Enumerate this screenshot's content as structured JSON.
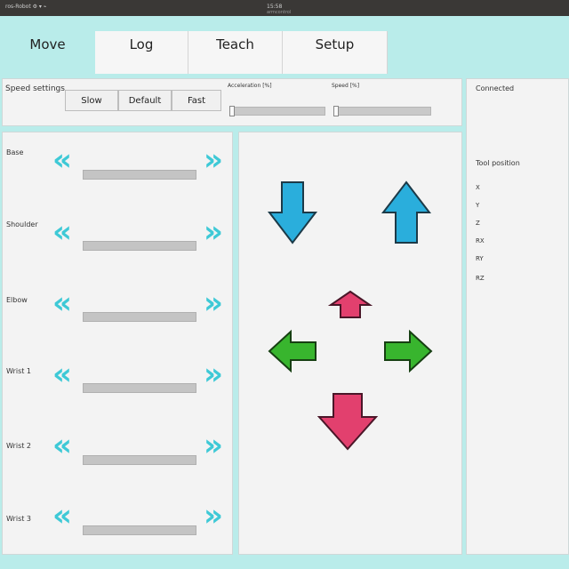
{
  "titlebar": {
    "left": "ros-Robot  ⚙ ▾ ⌁",
    "clock": "15:58",
    "title": "armcontrol"
  },
  "tabs": [
    {
      "label": "Move"
    },
    {
      "label": "Log"
    },
    {
      "label": "Teach"
    },
    {
      "label": "Setup"
    }
  ],
  "speed_settings": {
    "label": "Speed settings",
    "buttons": [
      "Slow",
      "Default",
      "Fast"
    ],
    "acceleration_label": "Acceleration [%]",
    "speed_label": "Speed [%]"
  },
  "joints": [
    {
      "label": "Base"
    },
    {
      "label": "Shoulder"
    },
    {
      "label": "Elbow"
    },
    {
      "label": "Wrist 1"
    },
    {
      "label": "Wrist 2"
    },
    {
      "label": "Wrist 3"
    }
  ],
  "joint_chevrons": {
    "left": "«",
    "right": "»"
  },
  "status": {
    "connection": "Connected",
    "tool_position_label": "Tool position",
    "axes": [
      "X",
      "Y",
      "Z",
      "RX",
      "RY",
      "RZ"
    ]
  },
  "colors": {
    "accent": "#3ec9d6",
    "arrow_blue": "#2aaedc",
    "arrow_green": "#38b52e",
    "arrow_pink": "#e2406e"
  }
}
